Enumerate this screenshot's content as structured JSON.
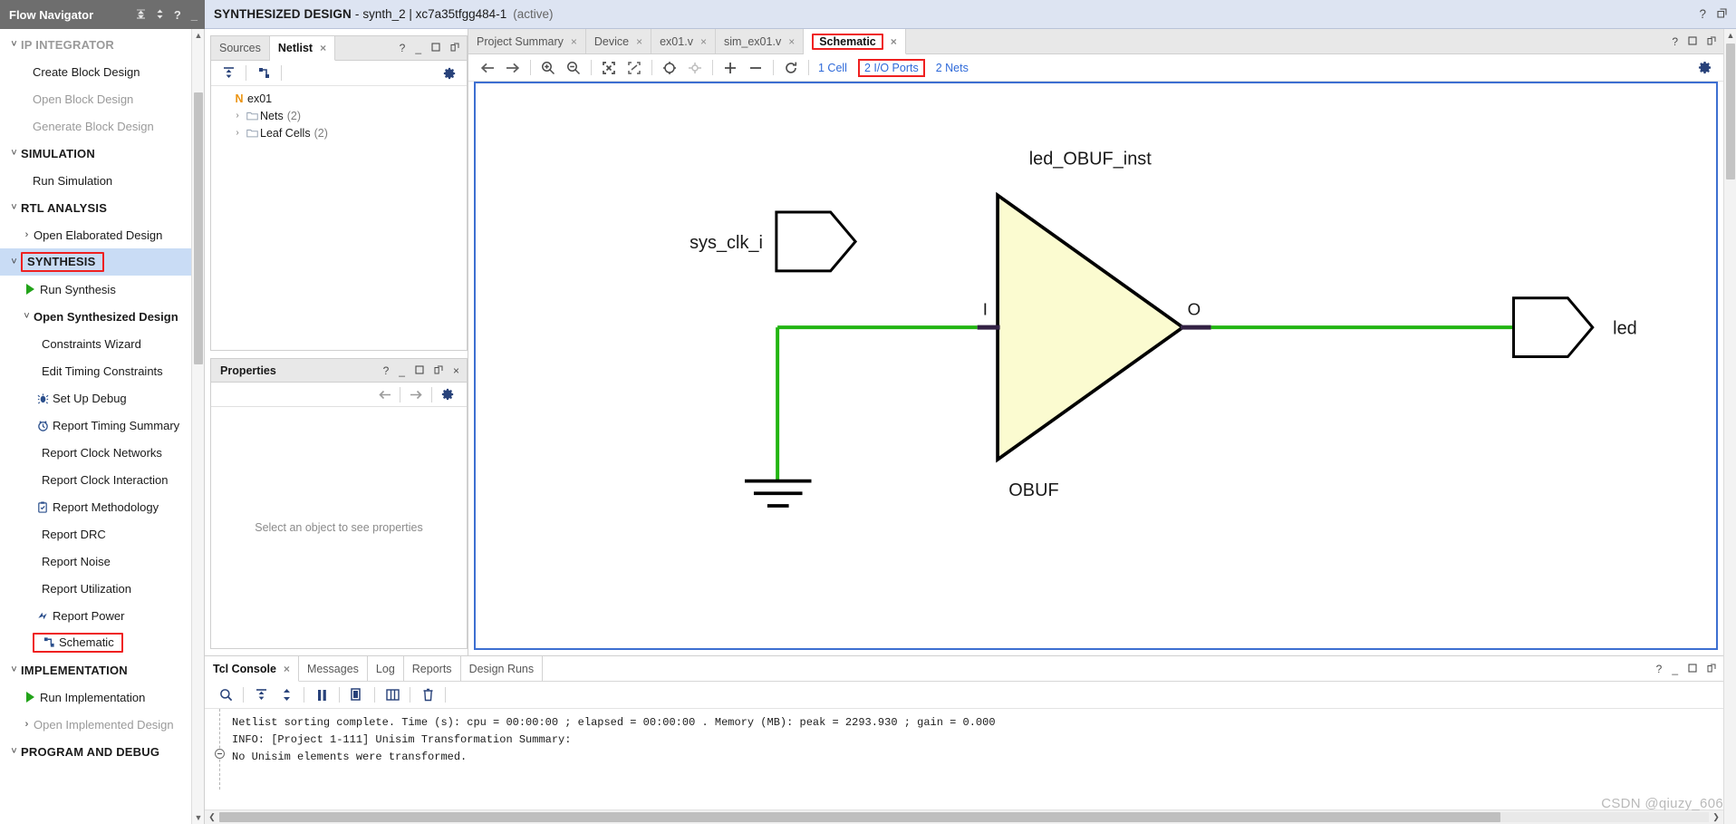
{
  "window": {
    "flow_navigator_title": "Flow Navigator",
    "doc_title_bold": "SYNTHESIZED DESIGN",
    "doc_title_dash": "-",
    "doc_title_rest": "synth_2 | xc7a35tfgg484-1",
    "doc_title_state": "(active)",
    "help_icon": "?",
    "minimize_icon": "_",
    "maximize_icon": "□",
    "restore_icon": "↗",
    "close_icon": "×",
    "collapse_icon": "collapse-all-icon",
    "updown_icon": "sort-icon"
  },
  "flow_navigator": {
    "items": [
      {
        "label": "IP INTEGRATOR",
        "type": "group",
        "chev": "˅",
        "indent": 0,
        "dim": true
      },
      {
        "label": "Create Block Design",
        "type": "item",
        "indent": 2,
        "dim": false
      },
      {
        "label": "Open Block Design",
        "type": "item",
        "indent": 2,
        "dim": true
      },
      {
        "label": "Generate Block Design",
        "type": "item",
        "indent": 2,
        "dim": true
      },
      {
        "label": "SIMULATION",
        "type": "group",
        "chev": "˅",
        "indent": 0,
        "dim": false
      },
      {
        "label": "Run Simulation",
        "type": "item",
        "indent": 2,
        "dim": false
      },
      {
        "label": "RTL ANALYSIS",
        "type": "group",
        "chev": "˅",
        "indent": 0,
        "dim": false
      },
      {
        "label": "Open Elaborated Design",
        "type": "item",
        "chev": "›",
        "indent": 1,
        "dim": false
      },
      {
        "label": "SYNTHESIS",
        "type": "group",
        "chev": "˅",
        "indent": 0,
        "selected": true,
        "highlight": true
      },
      {
        "label": "Run Synthesis",
        "type": "item",
        "icon": "play-icon",
        "indent": 1,
        "dim": false
      },
      {
        "label": "Open Synthesized Design",
        "type": "item",
        "chev": "˅",
        "indent": 1,
        "bold": true
      },
      {
        "label": "Constraints Wizard",
        "type": "item",
        "indent": 3,
        "dim": false
      },
      {
        "label": "Edit Timing Constraints",
        "type": "item",
        "indent": 3,
        "dim": false
      },
      {
        "label": "Set Up Debug",
        "type": "item",
        "icon": "bug-icon",
        "indent": 2,
        "dim": false
      },
      {
        "label": "Report Timing Summary",
        "type": "item",
        "icon": "clock-icon",
        "indent": 2,
        "dim": false
      },
      {
        "label": "Report Clock Networks",
        "type": "item",
        "indent": 3,
        "dim": false
      },
      {
        "label": "Report Clock Interaction",
        "type": "item",
        "indent": 3,
        "dim": false
      },
      {
        "label": "Report Methodology",
        "type": "item",
        "icon": "clipboard-icon",
        "indent": 2,
        "dim": false
      },
      {
        "label": "Report DRC",
        "type": "item",
        "indent": 3,
        "dim": false
      },
      {
        "label": "Report Noise",
        "type": "item",
        "indent": 3,
        "dim": false
      },
      {
        "label": "Report Utilization",
        "type": "item",
        "indent": 3,
        "dim": false
      },
      {
        "label": "Report Power",
        "type": "item",
        "icon": "power-icon",
        "indent": 2,
        "dim": false
      },
      {
        "label": "Schematic",
        "type": "item",
        "icon": "schematic-icon",
        "indent": 2,
        "highlight": true
      },
      {
        "label": "IMPLEMENTATION",
        "type": "group",
        "chev": "˅",
        "indent": 0,
        "dim": false
      },
      {
        "label": "Run Implementation",
        "type": "item",
        "icon": "play-icon",
        "indent": 1,
        "dim": false
      },
      {
        "label": "Open Implemented Design",
        "type": "item",
        "chev": "›",
        "indent": 1,
        "dim": true
      },
      {
        "label": "PROGRAM AND DEBUG",
        "type": "group",
        "chev": "˅",
        "indent": 0,
        "dim": false
      }
    ]
  },
  "netlist_panel": {
    "tabs": [
      {
        "label": "Sources",
        "active": false,
        "closable": false
      },
      {
        "label": "Netlist",
        "active": true,
        "closable": true
      }
    ],
    "close_icon": "×",
    "toolbar": [
      {
        "name": "collapse-all-icon"
      },
      {
        "name": "schematic-icon"
      }
    ],
    "gear_icon": "gear-icon",
    "tree": [
      {
        "label": "ex01",
        "badge": "N",
        "indent": 0,
        "chev": "",
        "count": ""
      },
      {
        "label": "Nets",
        "indent": 1,
        "chev": "›",
        "count": "(2)",
        "icon": "folder-icon"
      },
      {
        "label": "Leaf Cells",
        "indent": 1,
        "chev": "›",
        "count": "(2)",
        "icon": "folder-icon"
      }
    ]
  },
  "properties_panel": {
    "title": "Properties",
    "empty_text": "Select an object to see properties",
    "nav_back_icon": "arrow-left-icon",
    "nav_forward_icon": "arrow-right-icon",
    "gear_icon": "gear-icon"
  },
  "editor": {
    "tabs": [
      {
        "label": "Project Summary",
        "active": false,
        "closable": true
      },
      {
        "label": "Device",
        "active": false,
        "closable": true
      },
      {
        "label": "ex01.v",
        "active": false,
        "closable": true
      },
      {
        "label": "sim_ex01.v",
        "active": false,
        "closable": true
      },
      {
        "label": "Schematic",
        "active": true,
        "closable": true,
        "highlight": true
      }
    ],
    "close_icon": "×",
    "toolbar_icons": [
      {
        "name": "back-arrow-icon",
        "glyph": "←",
        "enabled": true
      },
      {
        "name": "forward-arrow-icon",
        "glyph": "→",
        "enabled": true
      },
      {
        "name": "zoom-in-icon",
        "glyph": "zoom-in",
        "enabled": true
      },
      {
        "name": "zoom-out-icon",
        "glyph": "zoom-out",
        "enabled": true
      },
      {
        "name": "zoom-fit-icon",
        "glyph": "fit",
        "enabled": true
      },
      {
        "name": "zoom-area-icon",
        "glyph": "area",
        "enabled": true
      },
      {
        "name": "regenerate-layout-icon",
        "glyph": "◌",
        "enabled": true
      },
      {
        "name": "expand-cone-icon",
        "glyph": "cone",
        "enabled": false
      },
      {
        "name": "add-cell-icon",
        "glyph": "+",
        "enabled": true
      },
      {
        "name": "remove-cell-icon",
        "glyph": "−",
        "enabled": true
      },
      {
        "name": "reload-icon",
        "glyph": "↻",
        "enabled": true
      }
    ],
    "stats": [
      {
        "label": "1 Cell",
        "highlight": false
      },
      {
        "label": "2 I/O Ports",
        "highlight": true
      },
      {
        "label": "2 Nets",
        "highlight": false
      }
    ],
    "gear_icon": "gear-icon"
  },
  "schematic": {
    "input_port_label": "sys_clk_i",
    "cell_instance_label": "led_OBUF_inst",
    "cell_type_label": "OBUF",
    "pin_in_label": "I",
    "pin_out_label": "O",
    "output_port_label": "led",
    "wire_color": "#22b512",
    "cell_fill": "#fbfbd0",
    "pin_color": "#332244"
  },
  "console": {
    "tabs": [
      {
        "label": "Tcl Console",
        "active": true,
        "closable": true
      },
      {
        "label": "Messages",
        "active": false,
        "closable": false
      },
      {
        "label": "Log",
        "active": false,
        "closable": false
      },
      {
        "label": "Reports",
        "active": false,
        "closable": false
      },
      {
        "label": "Design Runs",
        "active": false,
        "closable": false
      }
    ],
    "close_icon": "×",
    "toolbar_icons": [
      {
        "name": "search-icon"
      },
      {
        "name": "collapse-all-icon"
      },
      {
        "name": "expand-all-icon"
      },
      {
        "name": "pause-icon"
      },
      {
        "name": "copy-icon"
      },
      {
        "name": "columns-icon"
      },
      {
        "name": "trash-icon"
      }
    ],
    "lines": [
      "Netlist sorting complete. Time (s): cpu = 00:00:00 ; elapsed = 00:00:00 . Memory (MB): peak = 2293.930 ; gain = 0.000",
      "INFO: [Project 1-111] Unisim Transformation Summary:",
      "No Unisim elements were transformed."
    ]
  },
  "watermark": "CSDN @qiuzy_606",
  "colors": {
    "accent_blue": "#2f6ad9",
    "highlight_red": "#ef2020",
    "selection_blue": "#c9dcf5",
    "titlebar_grey": "#6e6e6e",
    "doc_title_bg": "#dde4f2"
  }
}
